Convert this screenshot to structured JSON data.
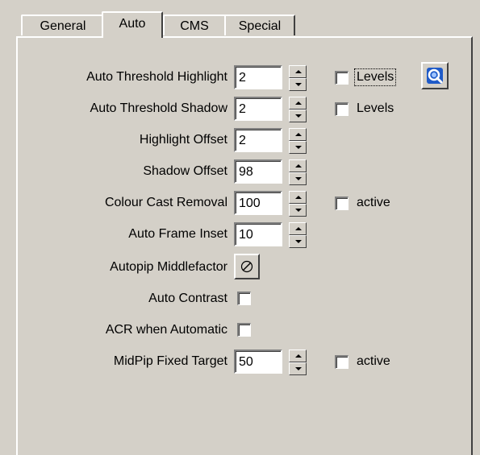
{
  "tabs": [
    {
      "label": "General",
      "active": false
    },
    {
      "label": "Auto",
      "active": true
    },
    {
      "label": "CMS",
      "active": false
    },
    {
      "label": "Special",
      "active": false
    }
  ],
  "rows": {
    "auto_threshold_highlight": {
      "label": "Auto Threshold Highlight",
      "value": "2",
      "checkbox_label": "Levels",
      "checked": false
    },
    "auto_threshold_shadow": {
      "label": "Auto Threshold Shadow",
      "value": "2",
      "checkbox_label": "Levels",
      "checked": false
    },
    "highlight_offset": {
      "label": "Highlight Offset",
      "value": "2"
    },
    "shadow_offset": {
      "label": "Shadow Offset",
      "value": "98"
    },
    "colour_cast_removal": {
      "label": "Colour Cast Removal",
      "value": "100",
      "checkbox_label": "active",
      "checked": false
    },
    "auto_frame_inset": {
      "label": "Auto Frame Inset",
      "value": "10"
    },
    "autopip_middlefactor": {
      "label": "Autopip Middlefactor"
    },
    "auto_contrast": {
      "label": "Auto Contrast",
      "checked": false
    },
    "acr_when_automatic": {
      "label": "ACR when Automatic",
      "checked": false
    },
    "midpip_fixed_target": {
      "label": "MidPip Fixed Target",
      "value": "50",
      "checkbox_label": "active",
      "checked": false
    }
  },
  "icons": {
    "levels_tool": "levels-magnifier-icon",
    "middlefactor": "pipette-icon"
  },
  "colors": {
    "face": "#d4d0c8",
    "highlight": "#ffffff",
    "shadow": "#404040",
    "icon_blue": "#1e5ac8"
  }
}
